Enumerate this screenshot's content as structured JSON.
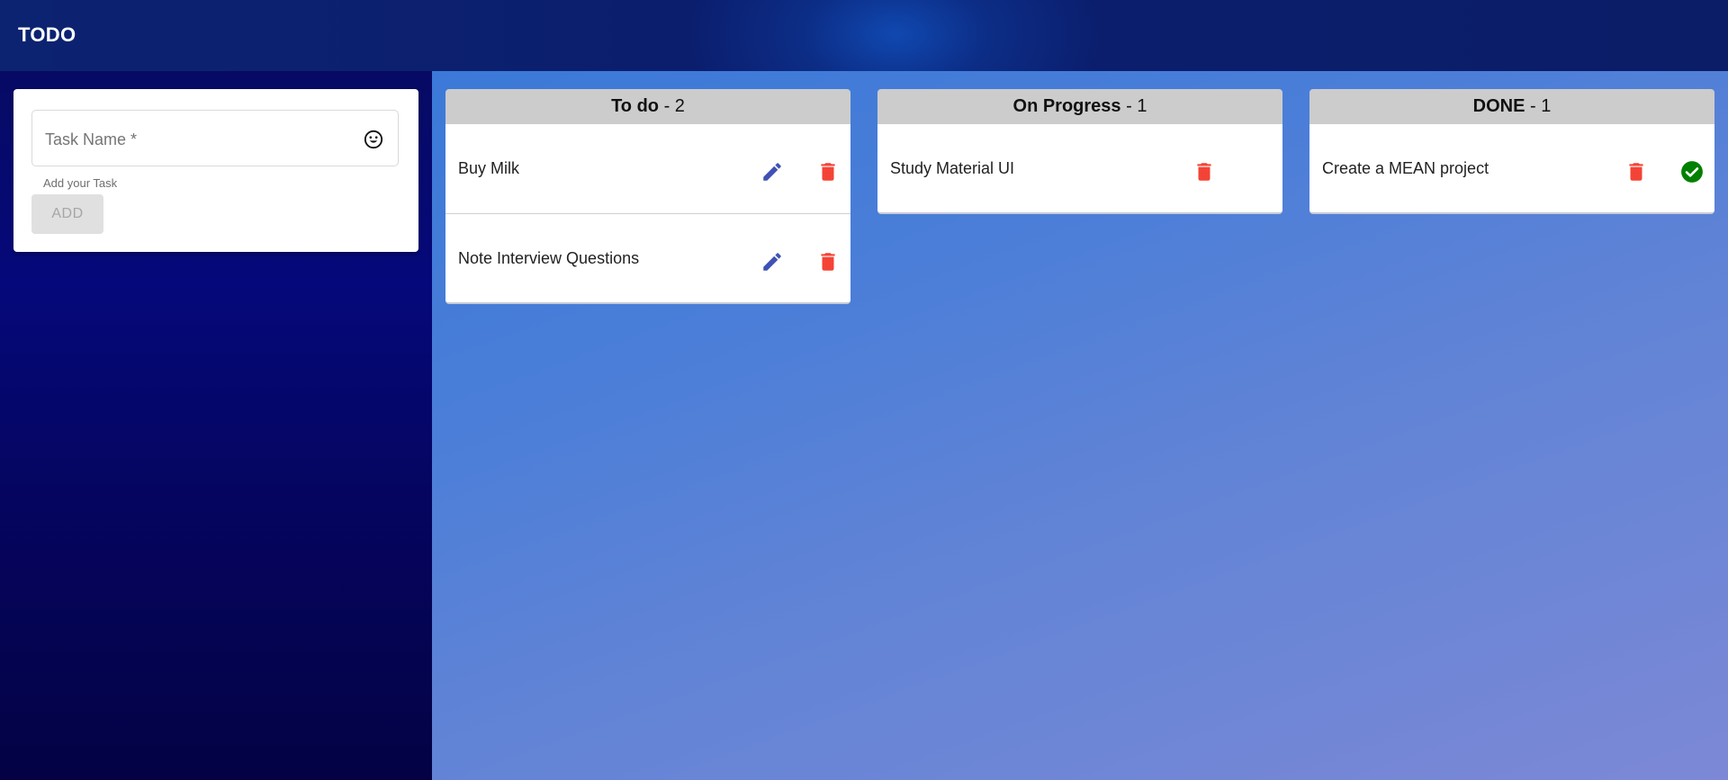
{
  "app": {
    "title": "TODO"
  },
  "sidebar": {
    "task_input": {
      "placeholder": "Task Name *",
      "value": "",
      "hint": "Add your Task",
      "emoji_icon": "smiley-icon"
    },
    "add_button_label": "ADD"
  },
  "board": {
    "separator": " - ",
    "columns": [
      {
        "name": "To do",
        "count": "2",
        "tasks": [
          {
            "text": "Buy Milk",
            "actions": [
              "edit-icon",
              "delete-icon"
            ]
          },
          {
            "text": "Note Interview Questions",
            "actions": [
              "edit-icon",
              "delete-icon"
            ]
          }
        ]
      },
      {
        "name": "On Progress",
        "count": "1",
        "tasks": [
          {
            "text": "Study Material UI",
            "actions": [
              "delete-icon"
            ]
          }
        ]
      },
      {
        "name": "DONE",
        "count": "1",
        "tasks": [
          {
            "text": "Create a MEAN project",
            "actions": [
              "delete-icon",
              "check-circle-icon"
            ]
          }
        ]
      }
    ]
  },
  "colors": {
    "header": "#0b1e6e",
    "sidebar": "#050660",
    "board_start": "#3b79d8",
    "board_end": "#7c88d6",
    "column_header": "#cccccc",
    "edit_icon": "#3f51b5",
    "delete_icon": "#f44336",
    "check_icon": "#008000"
  }
}
